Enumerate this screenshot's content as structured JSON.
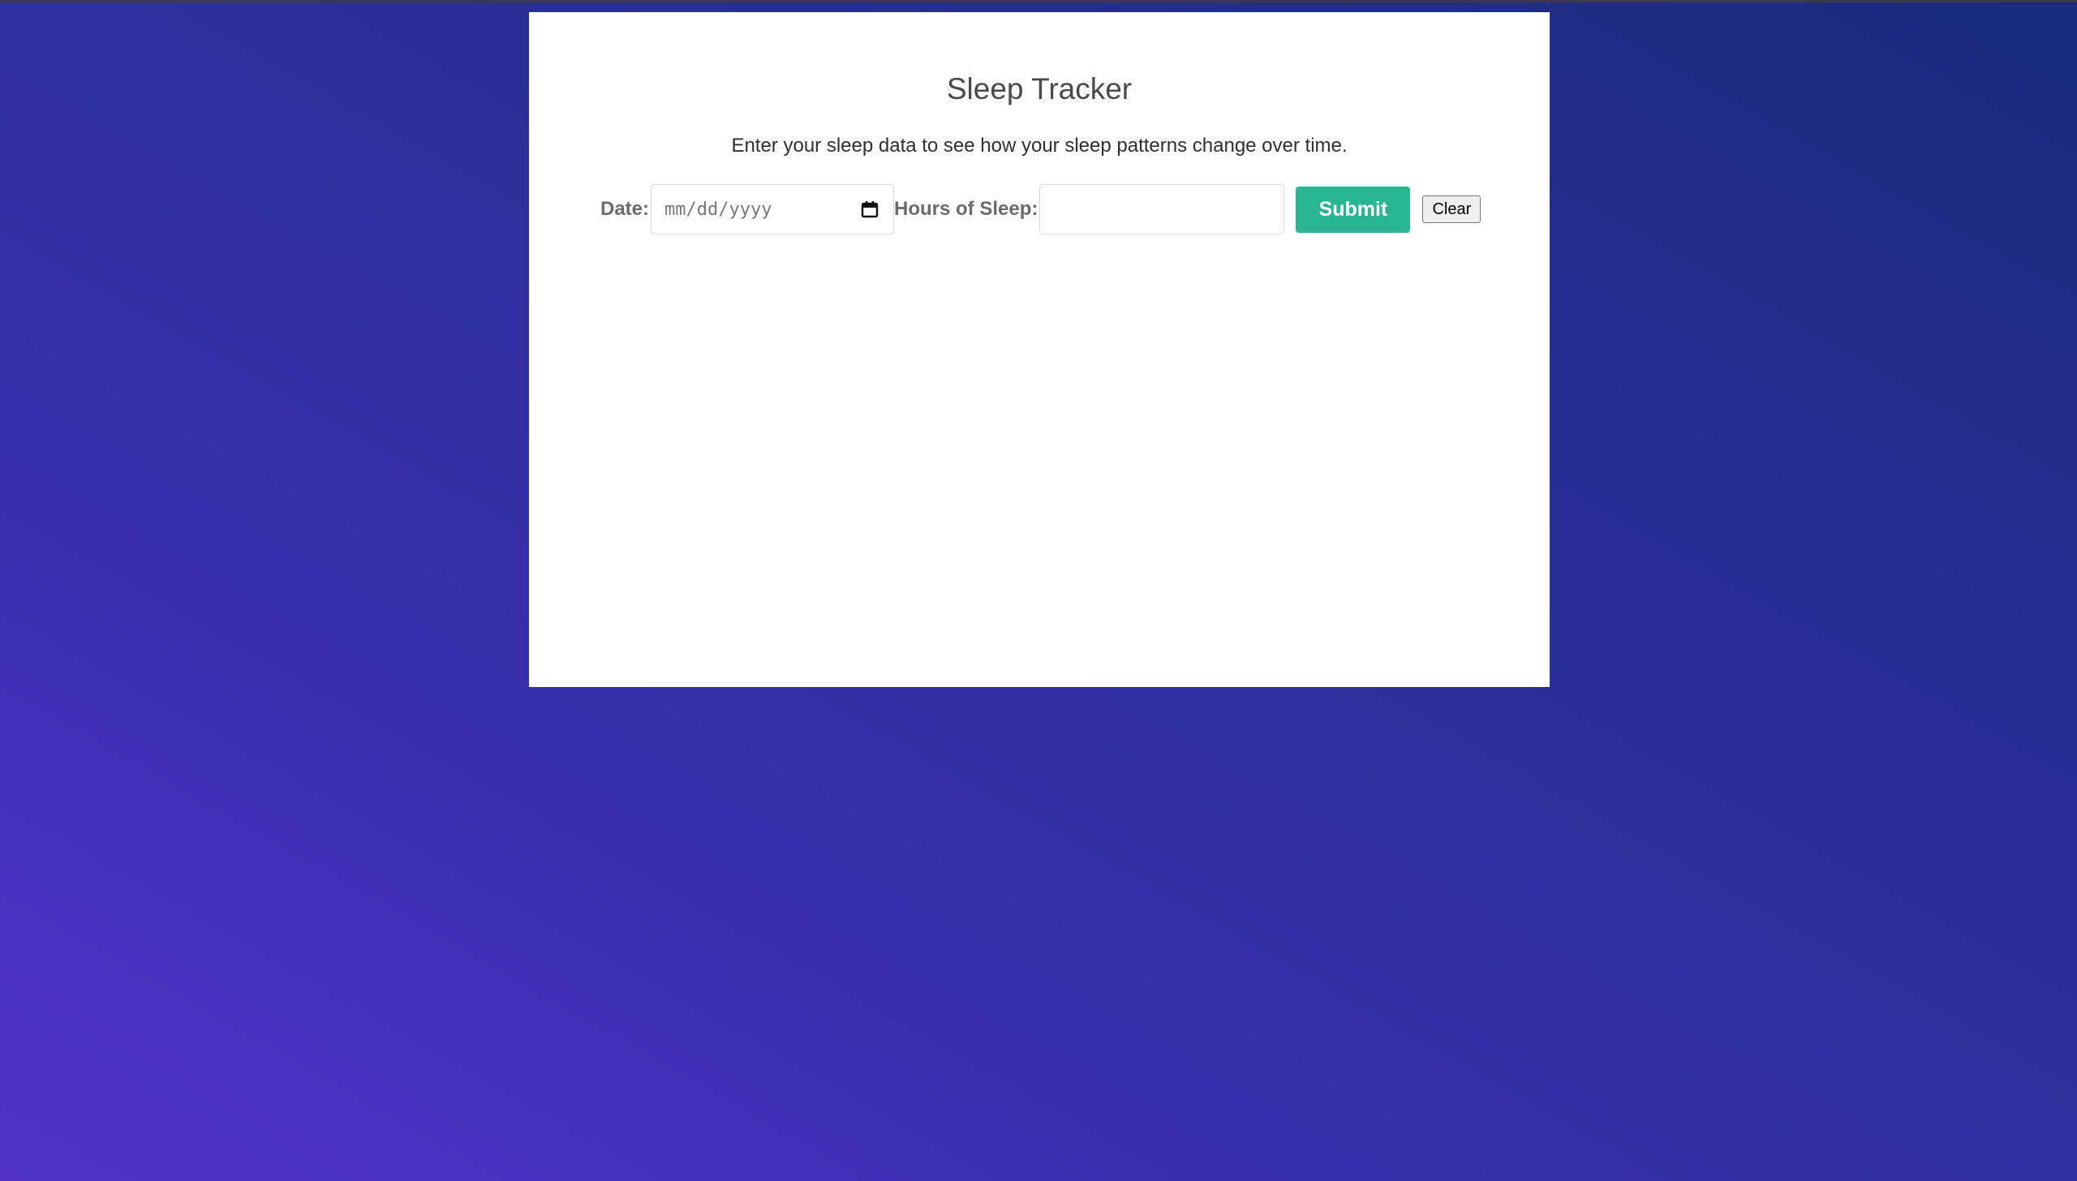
{
  "app": {
    "title": "Sleep Tracker",
    "subtitle": "Enter your sleep data to see how your sleep patterns change over time."
  },
  "form": {
    "date_label": "Date:",
    "date_placeholder": "mm/dd/yyyy",
    "hours_label": "Hours of Sleep:",
    "hours_value": "",
    "submit_label": "Submit",
    "clear_label": "Clear"
  },
  "colors": {
    "accent": "#27b592",
    "background_start": "#5033c6",
    "background_end": "#1b2c7c",
    "card": "#ffffff"
  },
  "icons": {
    "date_picker": "calendar-icon"
  }
}
